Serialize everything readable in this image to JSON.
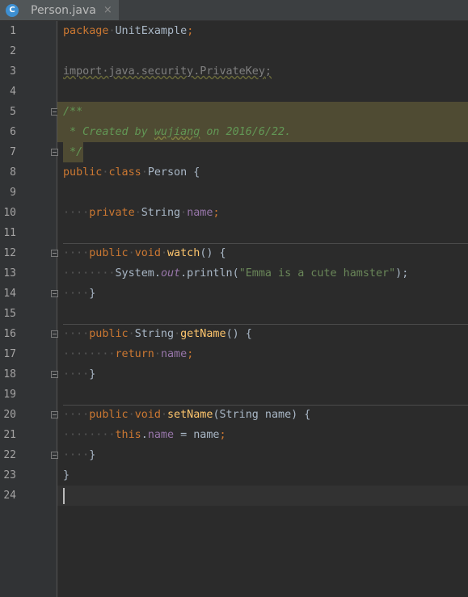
{
  "tab": {
    "icon_letter": "C",
    "title": "Person.java",
    "close": "×"
  },
  "gutter": {
    "line_numbers": [
      "1",
      "2",
      "3",
      "4",
      "5",
      "6",
      "7",
      "8",
      "9",
      "10",
      "11",
      "12",
      "13",
      "14",
      "15",
      "16",
      "17",
      "18",
      "19",
      "20",
      "21",
      "22",
      "23",
      "24"
    ]
  },
  "code": {
    "l1_kw": "package",
    "l1_rest": "UnitExample",
    "l1_semi": ";",
    "l3_kw": "import",
    "l3_rest": "java.security.PrivateKey",
    "l3_semi": ";",
    "l5": "/**",
    "l6_a": " * Created by ",
    "l6_b": "wujiang",
    "l6_c": " on 2016/6/22.",
    "l7": " */",
    "l8_kw1": "public",
    "l8_kw2": "class",
    "l8_rest": "Person {",
    "l10_kw": "private",
    "l10_type": "String",
    "l10_field": "name",
    "l10_semi": ";",
    "l12_kw1": "public",
    "l12_kw2": "void",
    "l12_fn": "watch",
    "l12_rest": "() {",
    "l13_a": "System.",
    "l13_out": "out",
    "l13_b": ".println(",
    "l13_str": "\"Emma is a cute hamster\"",
    "l13_c": ");",
    "l14": "}",
    "l16_kw": "public",
    "l16_type": "String",
    "l16_fn": "getName",
    "l16_rest": "() {",
    "l17_kw": "return",
    "l17_field": "name",
    "l17_semi": ";",
    "l18": "}",
    "l20_kw1": "public",
    "l20_kw2": "void",
    "l20_fn": "setName",
    "l20_rest": "(String name) {",
    "l21_kw": "this",
    "l21_dot": ".",
    "l21_field": "name",
    "l21_rest": " = name",
    "l21_semi": ";",
    "l22": "}",
    "l23": "}"
  },
  "colors": {
    "keyword": "#cc7832",
    "function": "#ffc66d",
    "field": "#9876aa",
    "string": "#6a8759",
    "comment": "#629755",
    "text": "#a9b7c6",
    "background": "#2b2b2b"
  }
}
